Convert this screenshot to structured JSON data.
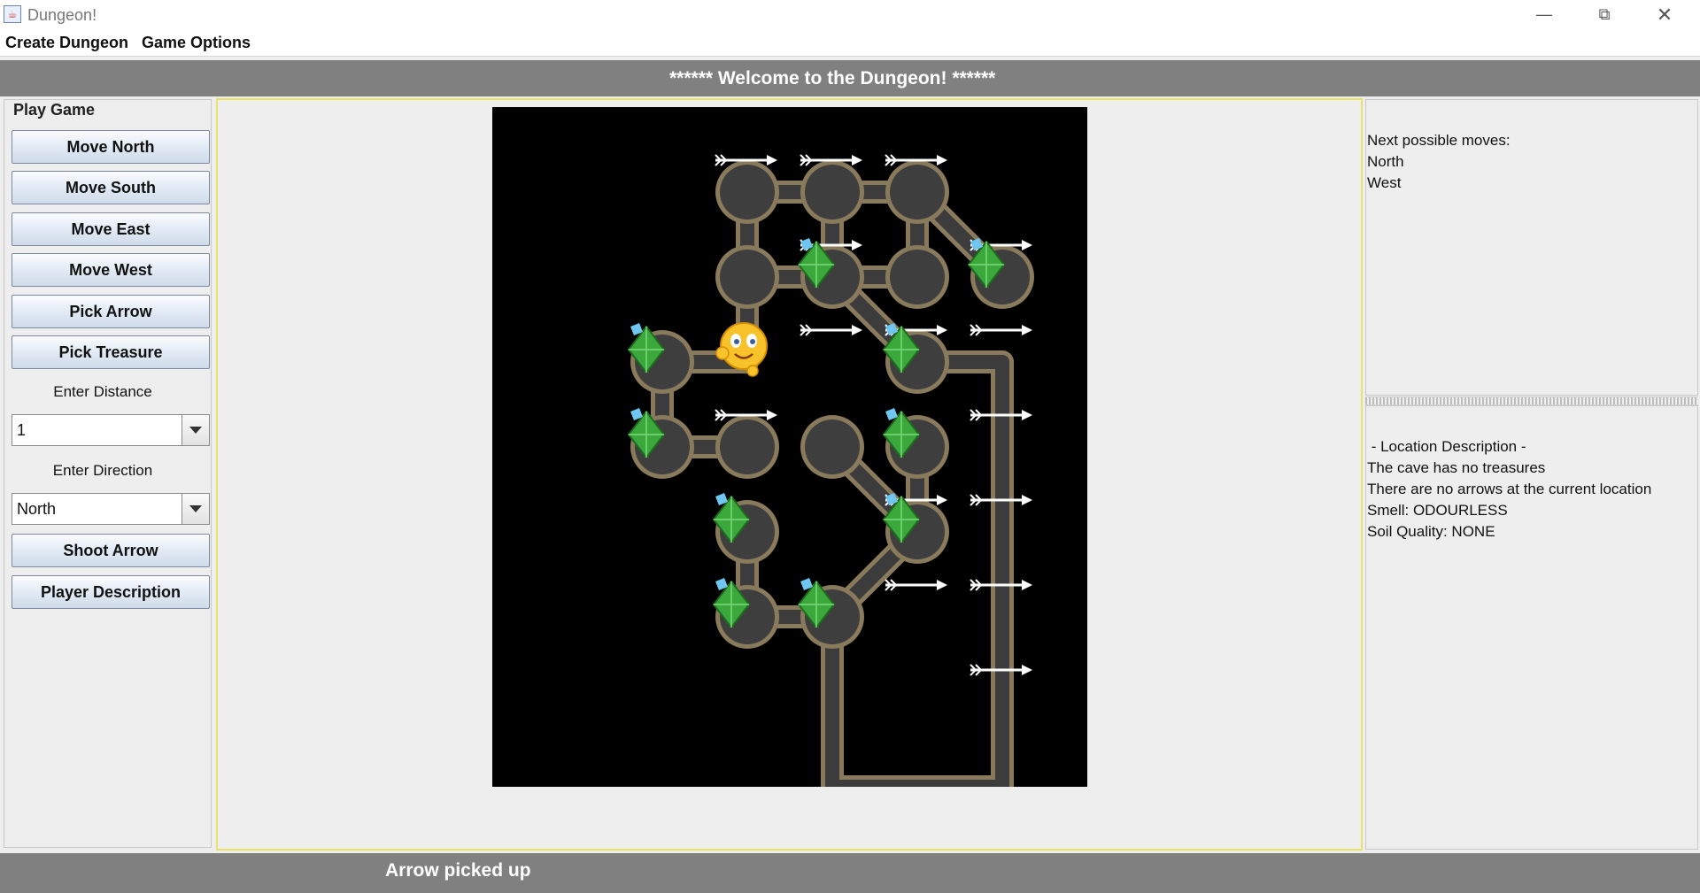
{
  "window": {
    "title": "Dungeon!",
    "minimize_icon": "minimize-icon",
    "maximize_icon": "restore-icon",
    "close_icon": "close-icon"
  },
  "menubar": {
    "items": [
      "Create Dungeon",
      "Game Options"
    ]
  },
  "header": {
    "welcome": "****** Welcome to the Dungeon! ******"
  },
  "play_panel": {
    "title": "Play Game",
    "buttons": {
      "move_north": "Move North",
      "move_south": "Move South",
      "move_east": "Move East",
      "move_west": "Move West",
      "pick_arrow": "Pick Arrow",
      "pick_treasure": "Pick Treasure",
      "shoot_arrow": "Shoot Arrow",
      "player_description": "Player Description"
    },
    "distance_label": "Enter Distance",
    "distance_value": "1",
    "direction_label": "Enter Direction",
    "direction_value": "North"
  },
  "moves_panel": {
    "heading": "Next possible moves:",
    "moves": [
      "North",
      "West"
    ]
  },
  "location_panel": {
    "heading": " - Location Description -",
    "lines": [
      "The cave has no treasures",
      "There are no arrows at the current location",
      "Smell: ODOURLESS",
      "Soil Quality: NONE"
    ]
  },
  "status": {
    "message": "Arrow picked up"
  },
  "dungeon_map": {
    "cols": 7,
    "rows": 8,
    "caves": [
      [
        3,
        1
      ],
      [
        4,
        1
      ],
      [
        5,
        1
      ],
      [
        3,
        2
      ],
      [
        4,
        2
      ],
      [
        5,
        2
      ],
      [
        6,
        2
      ],
      [
        2,
        3
      ],
      [
        5,
        3
      ],
      [
        2,
        4
      ],
      [
        3,
        4
      ],
      [
        4,
        4
      ],
      [
        5,
        4
      ],
      [
        3,
        5
      ],
      [
        5,
        5
      ],
      [
        3,
        6
      ],
      [
        4,
        6
      ]
    ],
    "tunnels": [
      [
        [
          3,
          1
        ],
        [
          4,
          1
        ]
      ],
      [
        [
          4,
          1
        ],
        [
          5,
          1
        ]
      ],
      [
        [
          5,
          1
        ],
        [
          6,
          2
        ]
      ],
      [
        [
          3,
          1
        ],
        [
          3,
          2
        ]
      ],
      [
        [
          4,
          1
        ],
        [
          4,
          2
        ]
      ],
      [
        [
          5,
          1
        ],
        [
          5,
          2
        ]
      ],
      [
        [
          3,
          2
        ],
        [
          4,
          2
        ]
      ],
      [
        [
          4,
          2
        ],
        [
          5,
          2
        ]
      ],
      [
        [
          3,
          2
        ],
        [
          3,
          3
        ]
      ],
      [
        [
          2,
          3
        ],
        [
          3,
          3
        ]
      ],
      [
        [
          4,
          2
        ],
        [
          5,
          3
        ]
      ],
      [
        [
          5,
          3
        ],
        [
          6,
          3
        ]
      ],
      [
        [
          6,
          3
        ],
        [
          6,
          8
        ]
      ],
      [
        [
          6,
          8
        ],
        [
          4,
          8
        ]
      ],
      [
        [
          4,
          8
        ],
        [
          4,
          6
        ]
      ],
      [
        [
          2,
          3
        ],
        [
          2,
          4
        ]
      ],
      [
        [
          2,
          4
        ],
        [
          3,
          4
        ]
      ],
      [
        [
          4,
          4
        ],
        [
          5,
          5
        ]
      ],
      [
        [
          5,
          4
        ],
        [
          5,
          5
        ]
      ],
      [
        [
          3,
          5
        ],
        [
          3,
          6
        ]
      ],
      [
        [
          3,
          6
        ],
        [
          4,
          6
        ]
      ],
      [
        [
          4,
          6
        ],
        [
          5,
          5
        ]
      ]
    ],
    "treasures": [
      [
        4,
        2
      ],
      [
        6,
        2
      ],
      [
        2,
        3
      ],
      [
        5,
        3
      ],
      [
        2,
        4
      ],
      [
        5,
        4
      ],
      [
        3,
        5
      ],
      [
        5,
        5
      ],
      [
        3,
        6
      ],
      [
        4,
        6
      ]
    ],
    "arrows": [
      [
        3,
        1
      ],
      [
        4,
        1
      ],
      [
        5,
        1
      ],
      [
        4,
        2
      ],
      [
        6,
        2
      ],
      [
        4,
        3
      ],
      [
        5,
        3
      ],
      [
        6,
        3
      ],
      [
        3,
        4
      ],
      [
        6,
        4
      ],
      [
        5,
        5
      ],
      [
        6,
        5
      ],
      [
        5,
        6
      ],
      [
        6,
        6
      ],
      [
        6,
        7
      ]
    ],
    "player": [
      3,
      3
    ]
  }
}
